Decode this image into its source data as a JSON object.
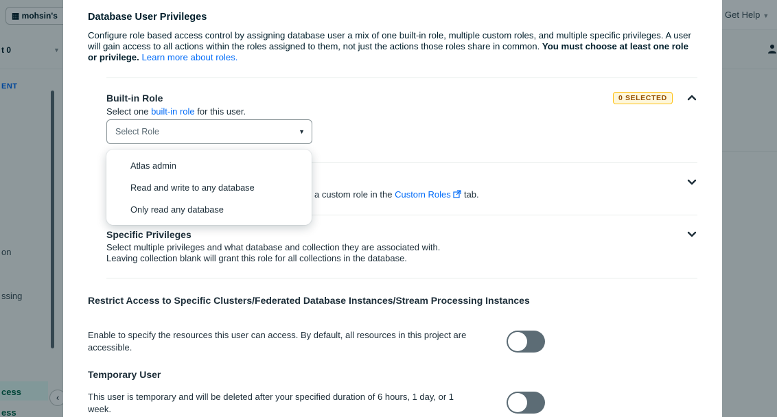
{
  "background": {
    "org_label": "mohsin's",
    "project_label": "t 0",
    "section_label": "ENT",
    "nav_items": [
      "on",
      "ssing",
      "cess",
      "ess"
    ],
    "help_label": "Get Help"
  },
  "modal": {
    "title": "Database User Privileges",
    "description": "Configure role based access control by assigning database user a mix of one built-in role, multiple custom roles, and multiple specific privileges. A user will gain access to all actions within the roles assigned to them, not just the actions those roles share in common.",
    "description_bold": "You must choose at least one role or privilege.",
    "learn_more_link": "Learn more about roles."
  },
  "builtin_role": {
    "title": "Built-in Role",
    "desc_prefix": "Select one",
    "desc_link": "built-in role",
    "desc_suffix": "for this user.",
    "badge": "0 SELECTED",
    "select_placeholder": "Select Role",
    "options": [
      "Atlas admin",
      "Read and write to any database",
      "Only read any database"
    ]
  },
  "custom_roles": {
    "desc_visible_part": "a custom role in the",
    "link": "Custom Roles",
    "suffix": "tab."
  },
  "specific_privileges": {
    "title": "Specific Privileges",
    "desc_line1": "Select multiple privileges and what database and collection they are associated with.",
    "desc_line2": "Leaving collection blank will grant this role for all collections in the database."
  },
  "restrict_access": {
    "title": "Restrict Access to Specific Clusters/Federated Database Instances/Stream Processing Instances",
    "description": "Enable to specify the resources this user can access. By default, all resources in this project are accessible.",
    "enabled": false
  },
  "temporary_user": {
    "title": "Temporary User",
    "description": "This user is temporary and will be deleted after your specified duration of 6 hours, 1 day, or 1 week.",
    "enabled": false
  },
  "colors": {
    "link": "#016bf8",
    "badge_bg": "#fef7db",
    "badge_border": "#ffc010",
    "badge_text": "#944f01",
    "toggle_off": "#5c6c75"
  }
}
